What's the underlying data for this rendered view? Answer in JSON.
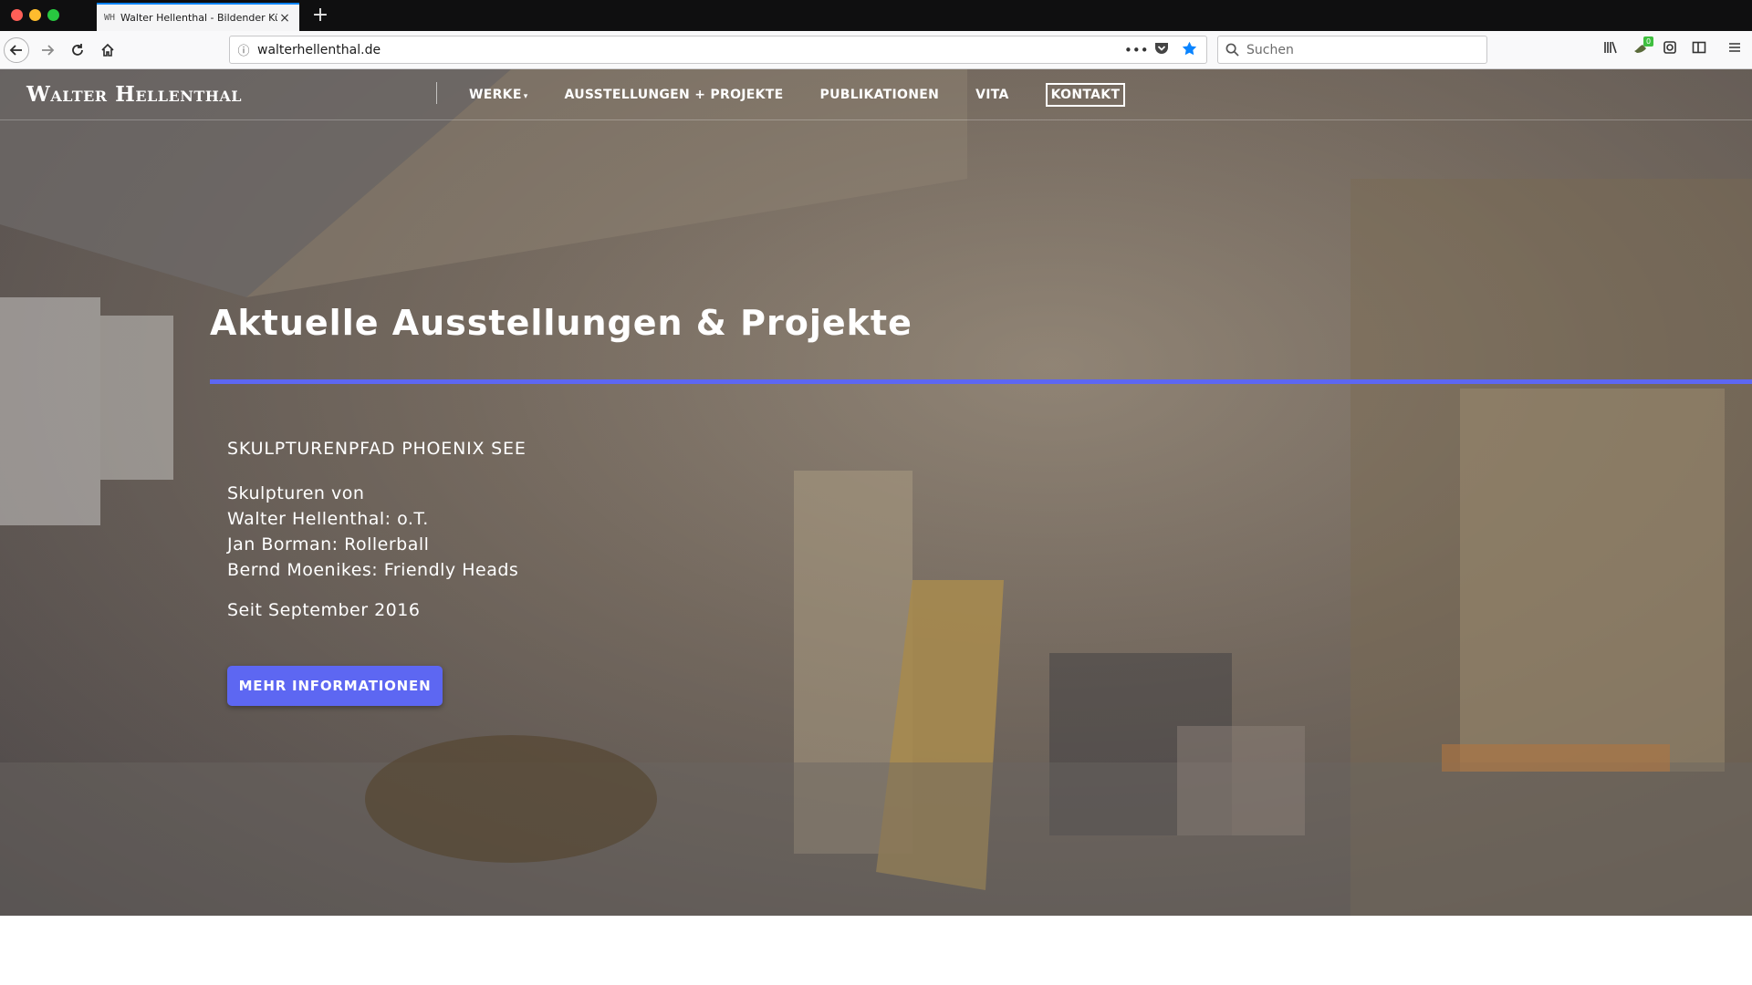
{
  "browser": {
    "tab": {
      "favicon": "WH",
      "title": "Walter Hellenthal - Bildender Kü",
      "close": "×"
    },
    "new_tab": "+",
    "url": "walterhellenthal.de",
    "search_placeholder": "Suchen",
    "url_actions": [
      "more-icon",
      "pocket-icon",
      "bookmark-star-icon"
    ],
    "toolbar_icons": [
      "library-icon",
      "extension-icon",
      "screenshot-icon",
      "sidebar-icon",
      "menu-icon"
    ],
    "extension_badge": "0",
    "accent_color": "#0a84ff"
  },
  "site": {
    "logo": "Walter Hellenthal",
    "nav": [
      {
        "label": "WERKE",
        "has_dropdown": true
      },
      {
        "label": "AUSSTELLUNGEN + PROJEKTE"
      },
      {
        "label": "PUBLIKATIONEN"
      },
      {
        "label": "VITA"
      },
      {
        "label": "KONTAKT",
        "boxed": true
      }
    ],
    "dropdown_caret": "▾"
  },
  "hero": {
    "title": "Aktuelle Ausstellungen & Projekte",
    "project_name": "SKULPTURENPFAD PHOENIX SEE",
    "lines": [
      "Skulpturen von",
      "Walter Hellenthal: o.T.",
      "Jan Borman: Rollerball",
      "Bernd Moenikes: Friendly Heads"
    ],
    "date": "Seit September 2016",
    "button_label": "MEHR INFORMATIONEN",
    "accent_color": "#5d67f2"
  }
}
